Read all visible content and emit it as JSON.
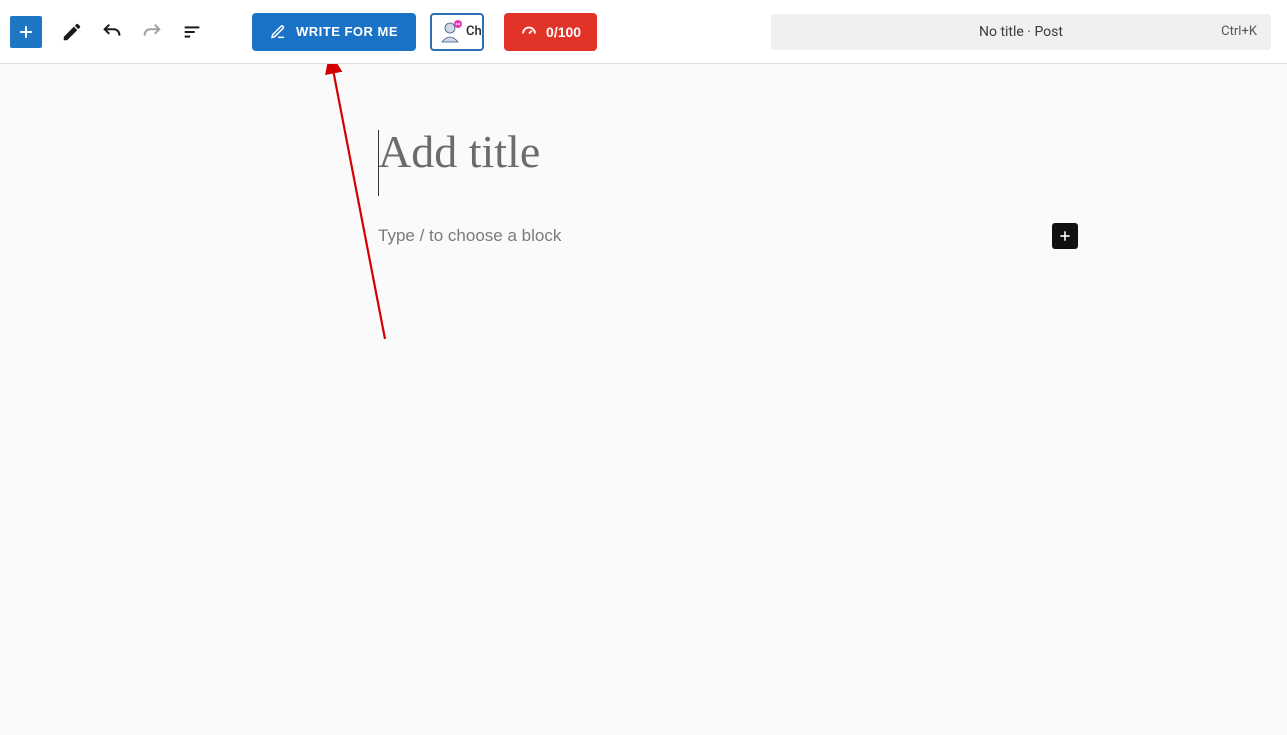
{
  "toolbar": {
    "write_label": "WRITE FOR ME",
    "ai_chip_label": "Ch",
    "score_label": "0/100"
  },
  "titlebar": {
    "text": "No title · Post",
    "shortcut": "Ctrl+K"
  },
  "editor": {
    "title_placeholder": "Add title",
    "block_placeholder": "Type / to choose a block"
  }
}
